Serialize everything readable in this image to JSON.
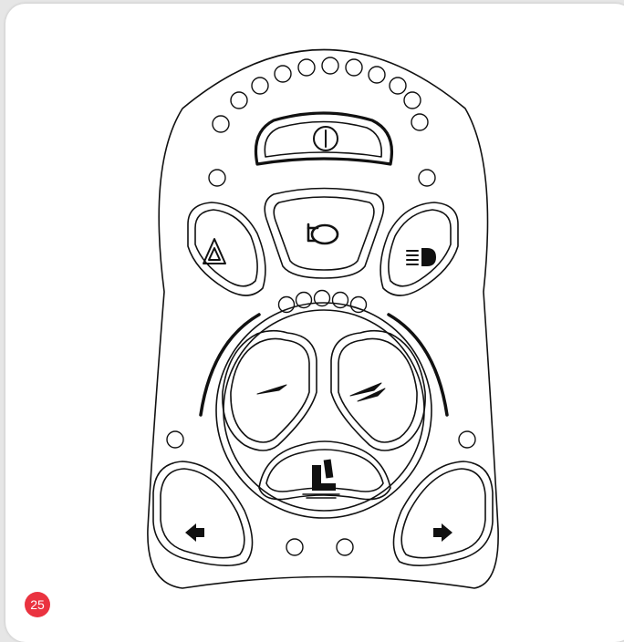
{
  "figure": {
    "number": "25",
    "badge_color": "#ea3340",
    "line_color": "#111111",
    "background": "#ffffff"
  },
  "panel": {
    "icons": {
      "power": "power-icon",
      "horn": "horn-icon",
      "hazard": "hazard-warning-icon",
      "lights": "headlight-icon",
      "speed_down": "speed-decrease-icon",
      "speed_up": "speed-increase-icon",
      "seat": "seat-actuator-icon",
      "left": "left-arrow-icon",
      "right": "right-arrow-icon"
    },
    "battery_leds": 12,
    "speed_leds": 5,
    "actuator_leds": 2
  }
}
